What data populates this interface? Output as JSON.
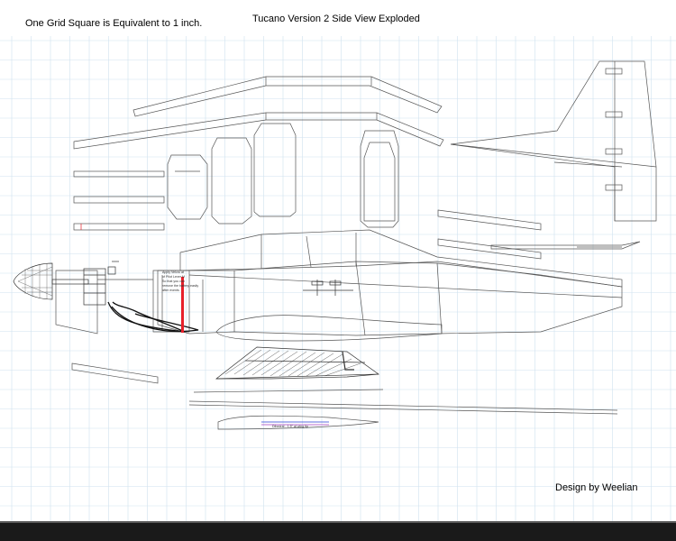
{
  "header": {
    "scale_note": "One Grid Square is Equivalent to 1 inch.",
    "title": "Tucano Version 2 Side View Exploded"
  },
  "footer": {
    "credit": "Design by Weelian"
  },
  "annotations": {
    "nose_note": [
      "Apply Velcro at",
      "of Pilot Lever M",
      "So that you can",
      "remove the battery easily",
      "after events"
    ],
    "wing_note": "Dihedral - 1.5\" at wing tip"
  },
  "colors": {
    "grid": "#cfe1ef",
    "line": "#555555",
    "marker": "#e8202a",
    "accent_blue": "#2a3fd6",
    "accent_purple": "#a43fbf"
  }
}
